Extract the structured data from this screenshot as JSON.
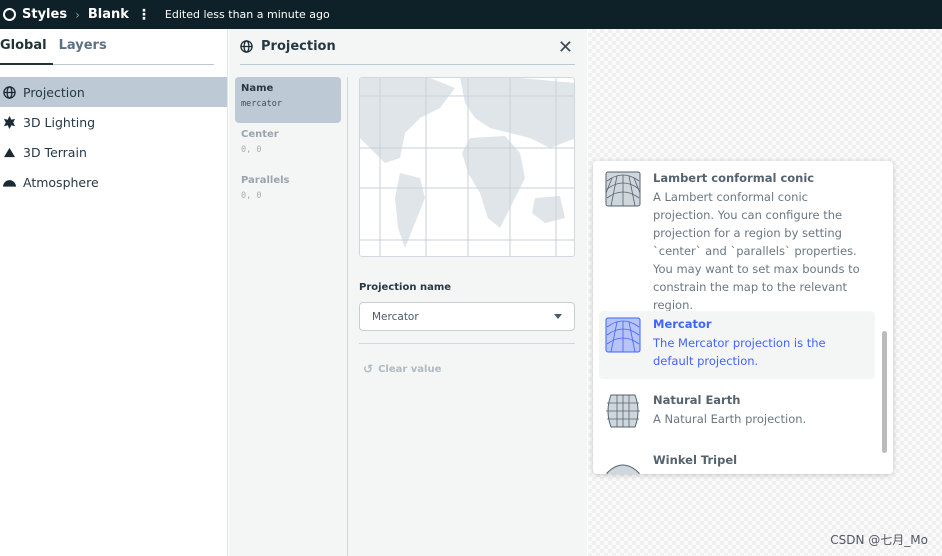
{
  "topbar": {
    "app": "Styles",
    "style_name": "Blank",
    "status": "Edited less than a minute ago"
  },
  "left": {
    "tabs": [
      {
        "label": "Global"
      },
      {
        "label": "Layers"
      }
    ],
    "items": [
      {
        "label": "Projection",
        "icon": "globe-icon"
      },
      {
        "label": "3D Lighting",
        "icon": "sun-icon"
      },
      {
        "label": "3D Terrain",
        "icon": "mountain-icon"
      },
      {
        "label": "Atmosphere",
        "icon": "atmosphere-icon"
      }
    ]
  },
  "panel": {
    "title": "Projection",
    "props": [
      {
        "key": "Name",
        "value": "mercator"
      },
      {
        "key": "Center",
        "value": "0, 0"
      },
      {
        "key": "Parallels",
        "value": "0, 0"
      }
    ],
    "field_label": "Projection name",
    "select_value": "Mercator",
    "clear_label": "Clear value"
  },
  "dropdown": {
    "options": [
      {
        "title": "Lambert conformal conic",
        "desc": "A Lambert conformal conic projection. You can configure the projection for a region by setting `center` and `parallels` properties. You may want to set max bounds to constrain the map to the relevant region."
      },
      {
        "title": "Mercator",
        "desc": "The Mercator projection is the default projection.",
        "selected": true
      },
      {
        "title": "Natural Earth",
        "desc": "A Natural Earth projection."
      },
      {
        "title": "Winkel Tripel",
        "desc": ""
      }
    ]
  },
  "colors": {
    "accent": "#4264fb",
    "topbar": "#0f2128",
    "active_bg": "#bdcad6"
  },
  "watermark": "CSDN @七月_Mo"
}
